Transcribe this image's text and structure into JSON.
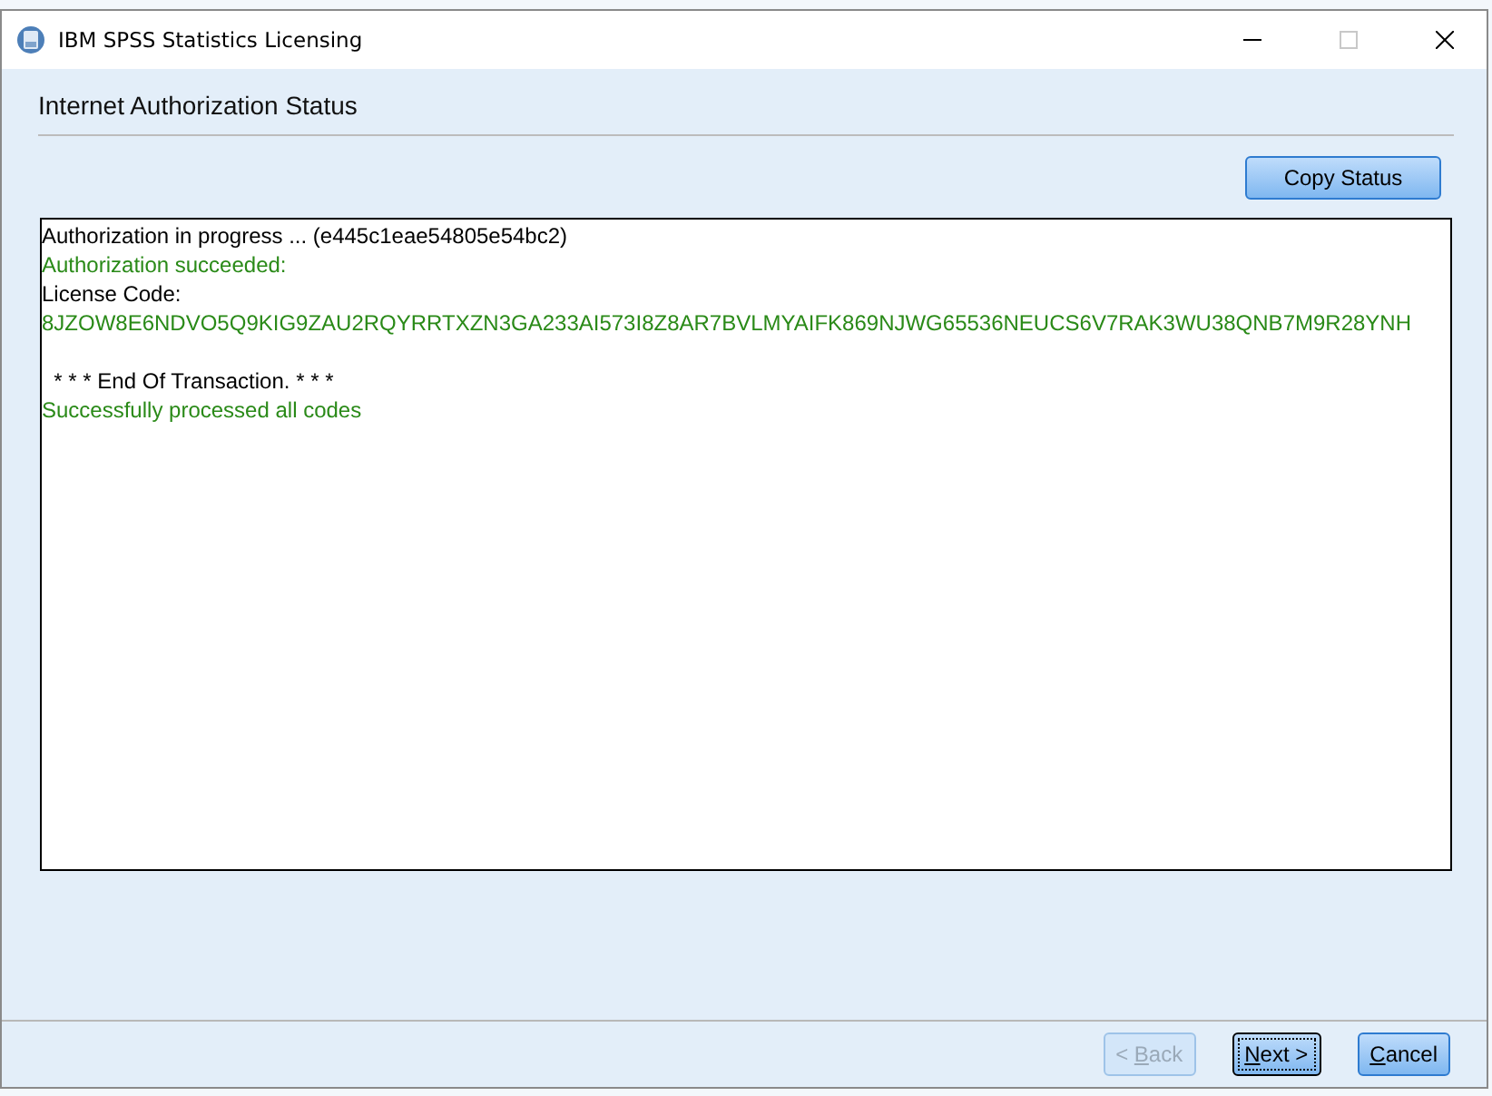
{
  "window": {
    "title": "IBM SPSS Statistics Licensing"
  },
  "heading": "Internet Authorization Status",
  "copy_button": {
    "label": "Copy Status"
  },
  "log_blocks": [
    {
      "lines": [
        {
          "text": "Authorization in progress ... (e445c1eae54805e54bc2)",
          "color": "#000000"
        },
        {
          "text": "Authorization succeeded:",
          "color": "#2a8a18"
        },
        {
          "text": "License Code:",
          "color": "#000000"
        },
        {
          "text": "8JZOW8E6NDVO5Q9KIG9ZAU2RQYRRTXZN3GA233AI573I8Z8AR7BVLMYAIFK869NJWG65536NEUCS6V7RAK3WU38QNB7M9R28YNH",
          "color": "#2a8a18"
        }
      ]
    },
    {
      "lines": [
        {
          "text": "  * * * End Of Transaction. * * *",
          "color": "#000000"
        },
        {
          "text": "Successfully processed all codes",
          "color": "#2a8a18"
        }
      ]
    }
  ],
  "buttons": [
    {
      "before": "< ",
      "key": "B",
      "after": "ack",
      "disabled": true,
      "focused": false
    },
    {
      "key": "N",
      "after": "ext >",
      "disabled": false,
      "focused": true
    },
    {
      "key": "C",
      "after": "ancel",
      "disabled": false,
      "focused": false
    }
  ]
}
